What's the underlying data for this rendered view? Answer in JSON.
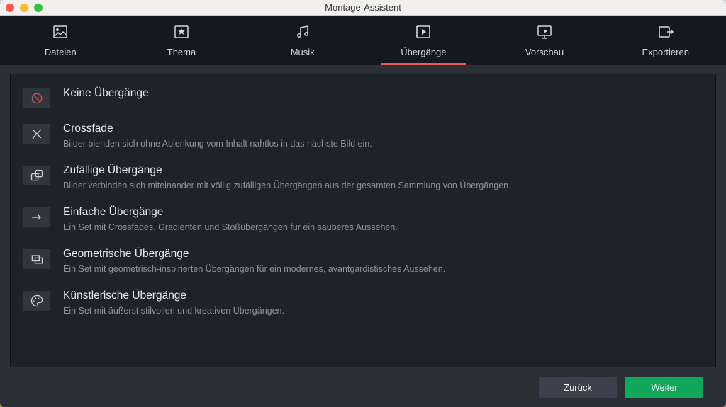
{
  "window": {
    "title": "Montage-Assistent"
  },
  "tabs": {
    "files": {
      "label": "Dateien"
    },
    "theme": {
      "label": "Thema"
    },
    "music": {
      "label": "Musik"
    },
    "trans": {
      "label": "Übergänge"
    },
    "preview": {
      "label": "Vorschau"
    },
    "export": {
      "label": "Exportieren"
    }
  },
  "options": {
    "none": {
      "title": "Keine Übergänge",
      "desc": ""
    },
    "crossfade": {
      "title": "Crossfade",
      "desc": "Bilder blenden sich ohne Ablenkung vom Inhalt nahtlos in das nächste Bild ein."
    },
    "random": {
      "title": "Zufällige Übergänge",
      "desc": "Bilder verbinden sich miteinander mit völlig zufälligen Übergängen aus der gesamten Sammlung von Übergängen."
    },
    "simple": {
      "title": "Einfache Übergänge",
      "desc": "Ein Set mit Crossfades, Gradienten und Stoßübergängen für ein sauberes Aussehen."
    },
    "geometric": {
      "title": "Geometrische Übergänge",
      "desc": "Ein Set mit geometrisch-inspirierten Übergängen für ein modernes, avantgardistisches Aussehen."
    },
    "artistic": {
      "title": "Künstlerische Übergänge",
      "desc": "Ein Set mit äußerst stilvollen und kreativen Übergängen."
    }
  },
  "footer": {
    "back": "Zurück",
    "next": "Weiter"
  },
  "colors": {
    "accent": "#ee5c54",
    "success": "#0fa85a"
  }
}
